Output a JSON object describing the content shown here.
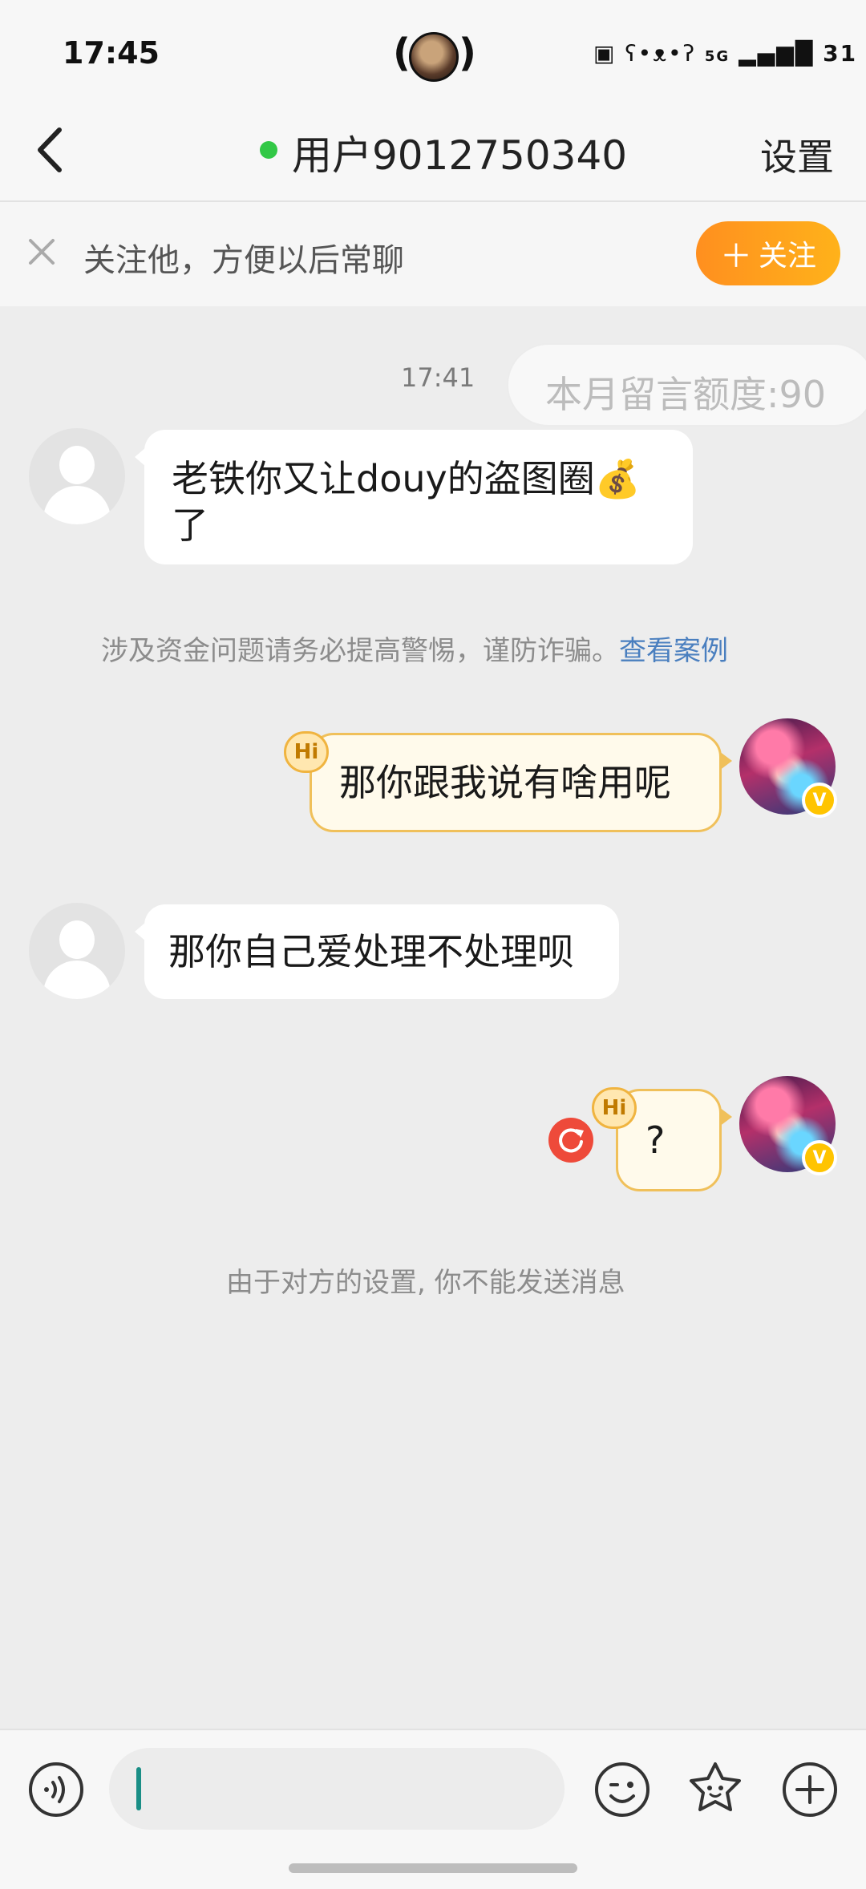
{
  "status_bar": {
    "time": "17:45",
    "network": "5G",
    "battery": "31"
  },
  "header": {
    "title": "用户9012750340",
    "settings_label": "设置",
    "online": true
  },
  "follow_bar": {
    "text": "关注他，方便以后常聊",
    "button_label": "关注"
  },
  "chat": {
    "timestamp": "17:41",
    "quota_text": "本月留言额度:90",
    "messages": [
      {
        "side": "left",
        "text": "老铁你又让douy的盗图圈💰了"
      },
      {
        "side": "right",
        "text": "那你跟我说有啥用呢",
        "badge": "Hi"
      },
      {
        "side": "left",
        "text": "那你自己爱处理不处理呗"
      },
      {
        "side": "right",
        "text": "?",
        "badge": "Hi"
      }
    ],
    "fraud_notice": "涉及资金问题请务必提高警惕，谨防诈骗。",
    "fraud_link": "查看案例",
    "blocked_notice": "由于对方的设置, 你不能发送消息"
  },
  "input_bar": {
    "value": ""
  },
  "colors": {
    "accent_orange": "#ff9a1f",
    "online_green": "#32c846",
    "link_blue": "#4a7fbf",
    "error_red": "#ee4a3a"
  }
}
